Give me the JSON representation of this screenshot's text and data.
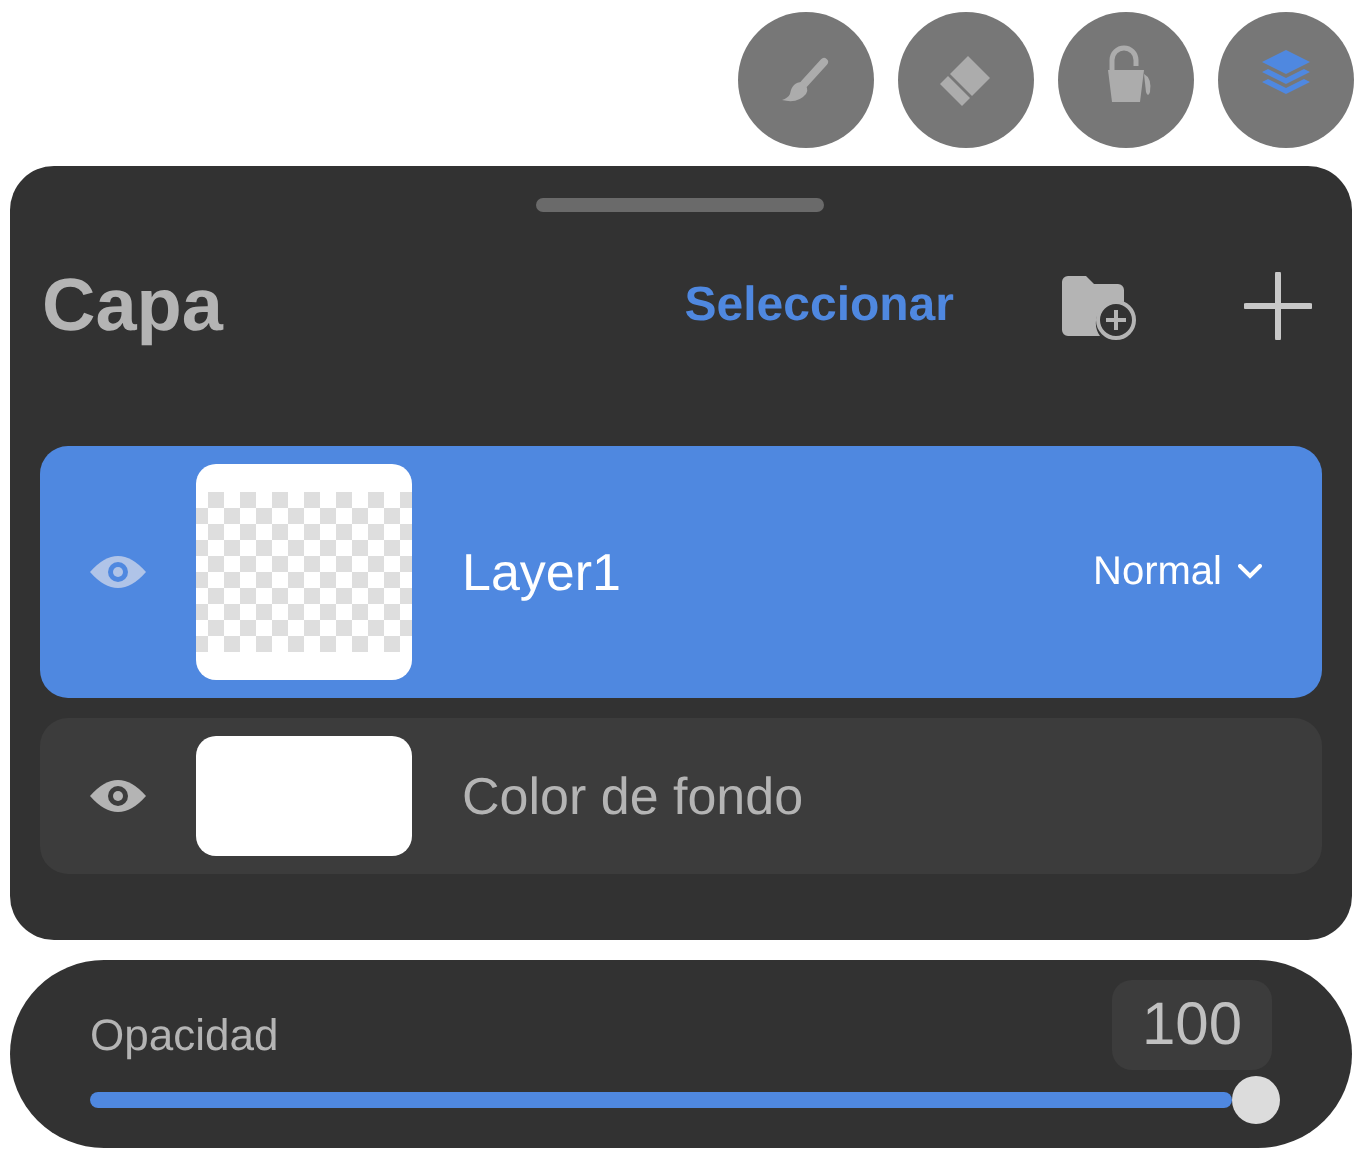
{
  "tools": [
    {
      "kind": "brush",
      "selected": false
    },
    {
      "kind": "eraser",
      "selected": false
    },
    {
      "kind": "fill",
      "selected": false
    },
    {
      "kind": "layers",
      "selected": true
    }
  ],
  "panel": {
    "title": "Capa",
    "select_button": "Seleccionar",
    "layers": [
      {
        "name": "Layer1",
        "selected": true,
        "visible": true,
        "kind": "transparent",
        "blend_mode": "Normal"
      },
      {
        "name": "Color de fondo",
        "selected": false,
        "visible": true,
        "kind": "white"
      }
    ]
  },
  "opacity": {
    "label": "Opacidad",
    "value": "100",
    "level": 1
  }
}
